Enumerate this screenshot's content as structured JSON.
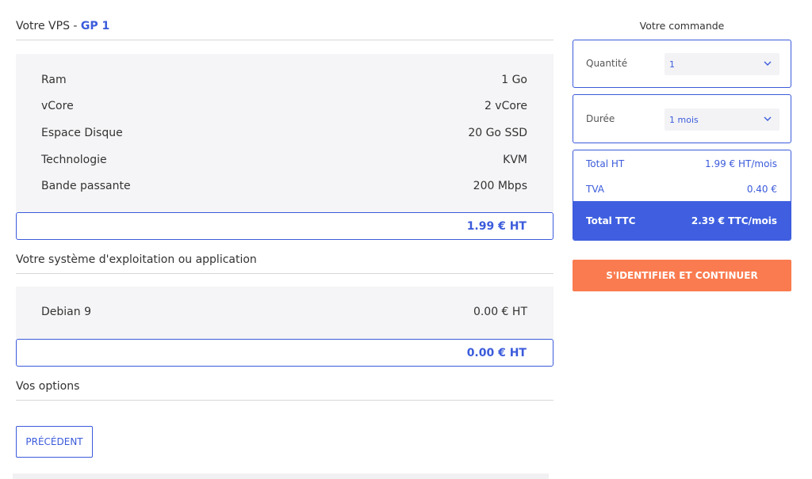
{
  "vps": {
    "title_prefix": "Votre VPS - ",
    "plan": "GP 1",
    "specs": [
      {
        "label": "Ram",
        "value": "1 Go"
      },
      {
        "label": "vCore",
        "value": "2 vCore"
      },
      {
        "label": "Espace Disque",
        "value": "20 Go SSD"
      },
      {
        "label": "Technologie",
        "value": "KVM"
      },
      {
        "label": "Bande passante",
        "value": "200 Mbps"
      }
    ],
    "total": "1.99 € HT"
  },
  "os": {
    "title": "Votre système d'exploitation ou application",
    "name": "Debian 9",
    "price": "0.00 € HT",
    "total": "0.00 € HT"
  },
  "options": {
    "title": "Vos options"
  },
  "nav": {
    "previous_label": "PRÉCÉDENT"
  },
  "order": {
    "title": "Votre commande",
    "quantity": {
      "label": "Quantité",
      "value": "1"
    },
    "duration": {
      "label": "Durée",
      "value": "1 mois"
    },
    "summary": {
      "total_ht_label": "Total HT",
      "total_ht_value": "1.99 € HT/mois",
      "tva_label": "TVA",
      "tva_value": "0.40 €",
      "total_ttc_label": "Total TTC",
      "total_ttc_value": "2.39 € TTC/mois"
    },
    "cta_label": "S'IDENTIFIER ET CONTINUER"
  },
  "colors": {
    "accent": "#3b5bdb",
    "cta": "#fa7b4f",
    "panel_bg": "#f5f5f7"
  }
}
